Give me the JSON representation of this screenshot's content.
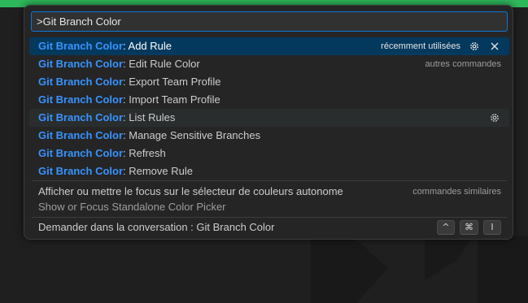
{
  "input": {
    "value": ">Git Branch Color"
  },
  "commands": [
    {
      "prefix": "Git Branch Color",
      "label": ": Add Rule",
      "group": "récemment utilisées",
      "selected": true
    },
    {
      "prefix": "Git Branch Color",
      "label": ": Edit Rule Color",
      "group": "autres commandes"
    },
    {
      "prefix": "Git Branch Color",
      "label": ": Export Team Profile"
    },
    {
      "prefix": "Git Branch Color",
      "label": ": Import Team Profile"
    },
    {
      "prefix": "Git Branch Color",
      "label": ": List Rules",
      "hover": true
    },
    {
      "prefix": "Git Branch Color",
      "label": ": Manage Sensitive Branches"
    },
    {
      "prefix": "Git Branch Color",
      "label": ": Refresh"
    },
    {
      "prefix": "Git Branch Color",
      "label": ": Remove Rule"
    }
  ],
  "similar": {
    "label": "Afficher ou mettre le focus sur le sélecteur de couleurs autonome",
    "detail": "Show or Focus Standalone Color Picker",
    "group": "commandes similaires"
  },
  "chat": {
    "label": "Demander dans la conversation : Git Branch Color",
    "keys": [
      "^",
      "⌘",
      "I"
    ]
  },
  "icons": {
    "gear": "gear-icon",
    "close": "close-icon"
  },
  "colors": {
    "accent": "#3794ff",
    "selection": "#04395e",
    "focus_border": "#0a78d4",
    "top_strip": "#2eb85c"
  }
}
